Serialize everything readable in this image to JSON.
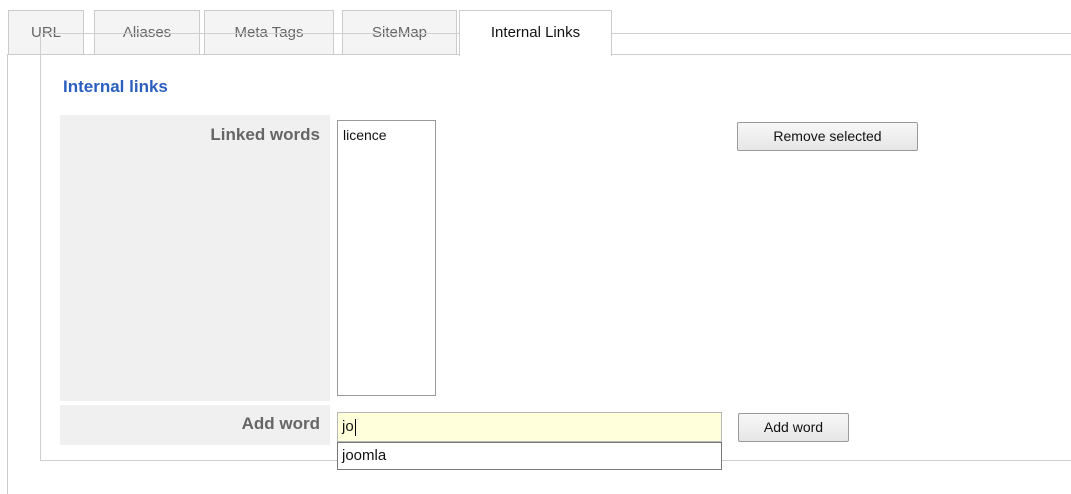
{
  "tabs": [
    {
      "label": "URL"
    },
    {
      "label": "Aliases"
    },
    {
      "label": "Meta Tags"
    },
    {
      "label": "SiteMap"
    },
    {
      "label": "Internal Links",
      "active": true
    }
  ],
  "section": {
    "legend": "Internal links"
  },
  "linked_words": {
    "label": "Linked words",
    "items": [
      "licence"
    ],
    "remove_button": "Remove selected"
  },
  "add_word": {
    "label": "Add word",
    "input_value": "jo",
    "suggestion": "joomla",
    "button": "Add word"
  },
  "colors": {
    "legend": "#2b5fbf",
    "input_bg": "#ffffdc"
  }
}
